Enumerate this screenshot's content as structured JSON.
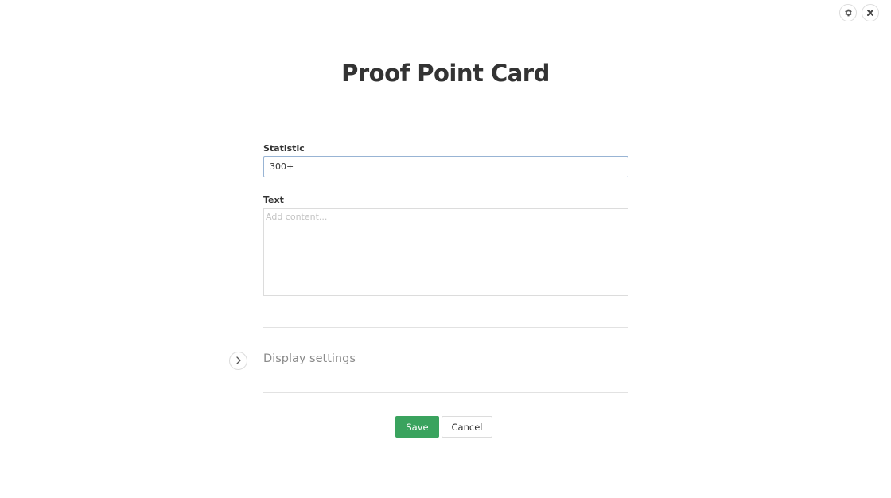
{
  "header": {
    "settings_icon": "gear-icon",
    "close_icon": "close-icon"
  },
  "title": "Proof Point Card",
  "form": {
    "statistic": {
      "label": "Statistic",
      "value": "300+"
    },
    "text": {
      "label": "Text",
      "placeholder": "Add content...",
      "value": ""
    }
  },
  "display_settings": {
    "label": "Display settings",
    "icon": "chevron-right-icon"
  },
  "actions": {
    "save_label": "Save",
    "cancel_label": "Cancel"
  },
  "colors": {
    "save_button": "#3aa35e",
    "focus_border": "#98b4d4"
  }
}
